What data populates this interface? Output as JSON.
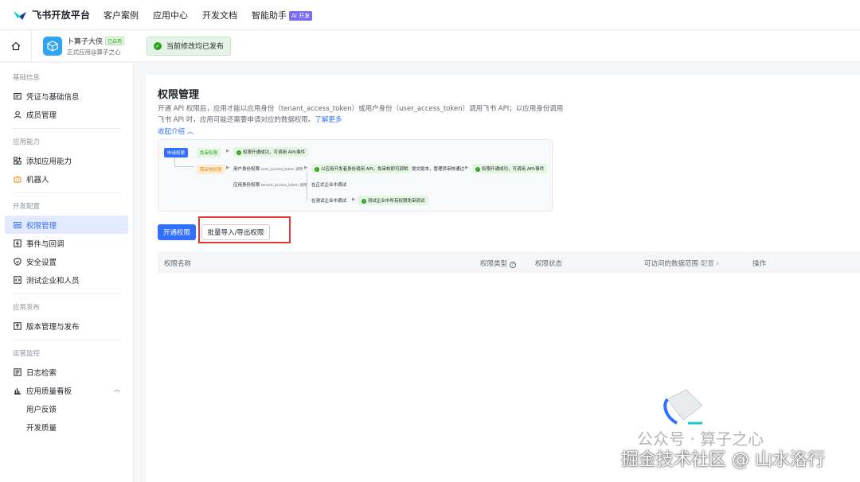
{
  "topbar": {
    "brand": "飞书开放平台",
    "nav": [
      "客户案例",
      "应用中心",
      "开发文档",
      "智能助手"
    ],
    "ai_badge": "AI 开发"
  },
  "app": {
    "name": "卜算子大侠",
    "status_tag": "已启用",
    "subtitle": "正式应用@算子之心",
    "publish_notice": "当前修改均已发布"
  },
  "sidebar": {
    "sections": [
      {
        "title": "基础信息",
        "items": [
          {
            "label": "凭证与基础信息",
            "icon": "credential-icon"
          },
          {
            "label": "成员管理",
            "icon": "member-icon"
          }
        ]
      },
      {
        "title": "应用能力",
        "items": [
          {
            "label": "添加应用能力",
            "icon": "grid-add-icon"
          },
          {
            "label": "机器人",
            "icon": "robot-icon"
          }
        ]
      },
      {
        "title": "开发配置",
        "items": [
          {
            "label": "权限管理",
            "icon": "permission-icon",
            "active": true
          },
          {
            "label": "事件与回调",
            "icon": "event-icon"
          },
          {
            "label": "安全设置",
            "icon": "shield-icon"
          },
          {
            "label": "测试企业和人员",
            "icon": "code-icon"
          }
        ]
      },
      {
        "title": "应用发布",
        "items": [
          {
            "label": "版本管理与发布",
            "icon": "upload-icon"
          }
        ]
      },
      {
        "title": "运营监控",
        "items": [
          {
            "label": "日志检索",
            "icon": "log-icon"
          },
          {
            "label": "应用质量看板",
            "icon": "chart-icon"
          },
          {
            "label": "用户反馈",
            "sub": true
          },
          {
            "label": "开发质量",
            "sub": true
          }
        ]
      }
    ]
  },
  "main": {
    "title": "权限管理",
    "desc": "开通 API 权限后，应用才能以应用身份（tenant_access_token）或用户身份（user_access_token）调用飞书 API；以应用身份调用飞书 API 时，应用可能还需要申请对应的数据权限。",
    "learn_more": "了解更多",
    "collapse": "收起介绍",
    "diagram": {
      "tag_apply": "申请权限",
      "tag_free": "免审权限",
      "tag_review": "需审核权限",
      "ok_free": "权限开通成功，可调用 API/事件",
      "user_identity": "用户身份权限",
      "user_token": "user_access_token 调用",
      "ok_user": "以应用开发者身份调用 API，免审核即可调试",
      "submit": "提交版本，管理员审核通过",
      "ok_final": "权限开通成功，可调用 API/事件",
      "app_identity": "应用身份权限",
      "tenant_token": "tenant_access_token 调用",
      "prod_debug": "在正式企业中调试",
      "test_debug": "在测试企业中调试",
      "ok_test": "测试企业中所有权限免审调试"
    },
    "btn_enable": "开通权限",
    "btn_batch": "批量导入/导出权限",
    "table_headers": {
      "name": "权限名称",
      "type": "权限类型",
      "status": "权限状态",
      "scope": "可访问的数据范围",
      "scope_link": "配置",
      "ops": "操作"
    }
  },
  "watermark": {
    "line1": "公众号 · 算子之心",
    "line2": "掘金技术社区 @ 山水洛行"
  }
}
